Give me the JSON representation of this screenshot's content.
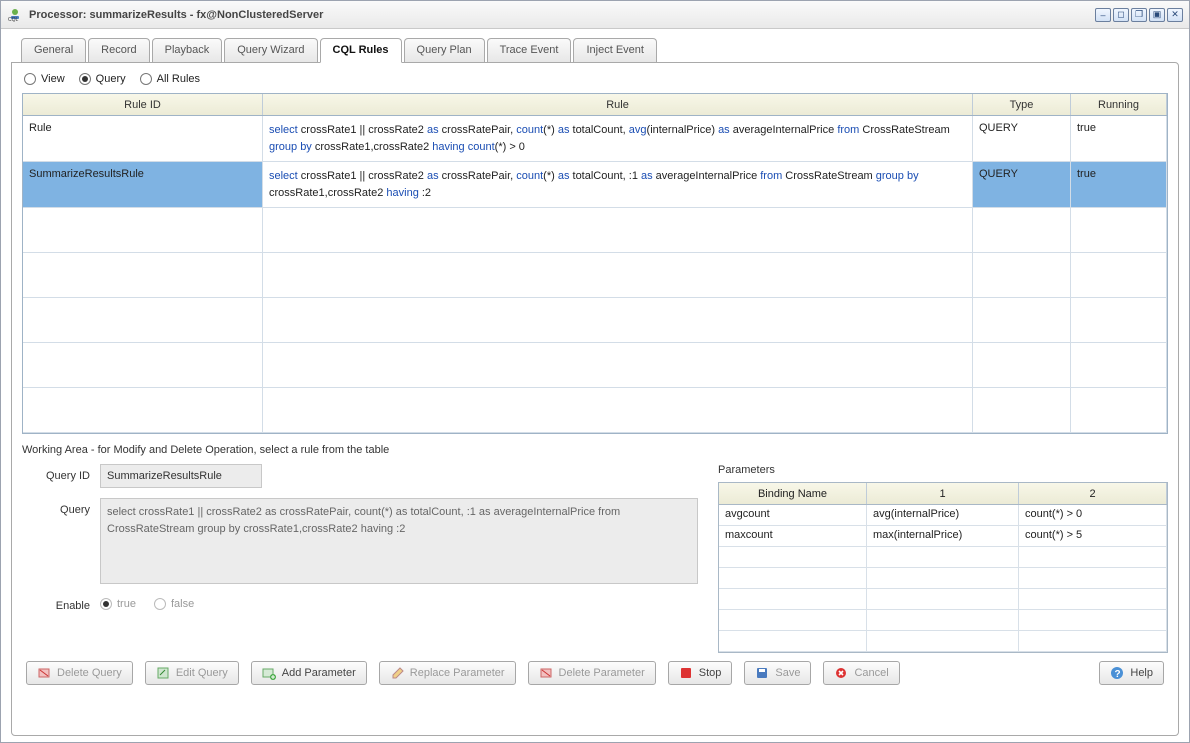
{
  "title_text": "Processor: summarizeResults - fx@NonClusteredServer",
  "tabs": [
    "General",
    "Record",
    "Playback",
    "Query Wizard",
    "CQL Rules",
    "Query Plan",
    "Trace Event",
    "Inject Event"
  ],
  "active_tab_index": 4,
  "filter": {
    "view": "View",
    "query": "Query",
    "all_rules": "All Rules"
  },
  "rules_table": {
    "columns": [
      "Rule ID",
      "Rule",
      "Type",
      "Running"
    ],
    "rows": [
      {
        "id": "Rule",
        "sql": [
          [
            "kw",
            "select"
          ],
          [
            "plain",
            " crossRate1 || crossRate2 "
          ],
          [
            "kw",
            "as"
          ],
          [
            "plain",
            " crossRatePair, "
          ],
          [
            "kw",
            "count"
          ],
          [
            "plain",
            "(*) "
          ],
          [
            "kw",
            "as"
          ],
          [
            "plain",
            " totalCount, "
          ],
          [
            "kw",
            "avg"
          ],
          [
            "plain",
            "(internalPrice) "
          ],
          [
            "kw",
            "as"
          ],
          [
            "plain",
            " averageInternalPrice "
          ],
          [
            "kw",
            "from"
          ],
          [
            "plain",
            " CrossRateStream "
          ],
          [
            "kw",
            "group by"
          ],
          [
            "plain",
            " crossRate1,crossRate2 "
          ],
          [
            "kw",
            "having"
          ],
          [
            "plain",
            " "
          ],
          [
            "kw",
            "count"
          ],
          [
            "plain",
            "(*) > 0"
          ]
        ],
        "type": "QUERY",
        "running": "true",
        "selected": false
      },
      {
        "id": "SummarizeResultsRule",
        "sql": [
          [
            "kw",
            "select"
          ],
          [
            "plain",
            " crossRate1 || crossRate2 "
          ],
          [
            "kw",
            "as"
          ],
          [
            "plain",
            " crossRatePair, "
          ],
          [
            "kw",
            "count"
          ],
          [
            "plain",
            "(*) "
          ],
          [
            "kw",
            "as"
          ],
          [
            "plain",
            " totalCount, :1 "
          ],
          [
            "kw",
            "as"
          ],
          [
            "plain",
            " averageInternalPrice "
          ],
          [
            "kw",
            "from"
          ],
          [
            "plain",
            " CrossRateStream "
          ],
          [
            "kw",
            "group by"
          ],
          [
            "plain",
            " crossRate1,crossRate2 "
          ],
          [
            "kw",
            "having"
          ],
          [
            "plain",
            " :2"
          ]
        ],
        "type": "QUERY",
        "running": "true",
        "selected": true
      }
    ]
  },
  "working_label": "Working Area - for Modify and Delete Operation, select a rule from the table",
  "form": {
    "query_id_label": "Query ID",
    "query_id_value": "SummarizeResultsRule",
    "query_label": "Query",
    "query_value": "select crossRate1 || crossRate2 as crossRatePair, count(*) as totalCount, :1 as averageInternalPrice from CrossRateStream group by crossRate1,crossRate2 having :2",
    "enable_label": "Enable",
    "true": "true",
    "false": "false"
  },
  "parameters": {
    "title": "Parameters",
    "columns": [
      "Binding Name",
      "1",
      "2"
    ],
    "rows": [
      {
        "name": "avgcount",
        "c1": "avg(internalPrice)",
        "c2": "count(*) > 0"
      },
      {
        "name": "maxcount",
        "c1": "max(internalPrice)",
        "c2": "count(*) > 5"
      }
    ]
  },
  "buttons": {
    "delete_query": "Delete Query",
    "edit_query": "Edit Query",
    "add_param": "Add Parameter",
    "replace_param": "Replace Parameter",
    "delete_param": "Delete Parameter",
    "stop": "Stop",
    "save": "Save",
    "cancel": "Cancel",
    "help": "Help"
  }
}
